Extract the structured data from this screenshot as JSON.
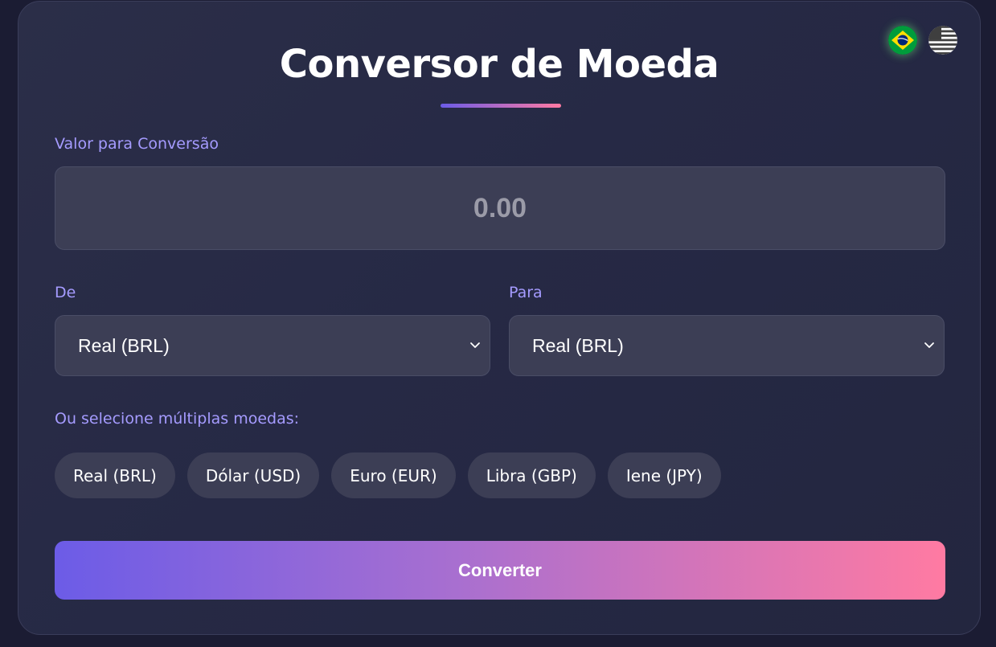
{
  "header": {
    "title": "Conversor de Moeda",
    "languages": [
      {
        "code": "pt-BR",
        "icon": "brazil-flag-icon",
        "active": true
      },
      {
        "code": "en-US",
        "icon": "usa-flag-icon",
        "active": false
      }
    ]
  },
  "amount": {
    "label": "Valor para Conversão",
    "placeholder": "0.00",
    "value": ""
  },
  "from": {
    "label": "De",
    "selected": "Real (BRL)"
  },
  "to": {
    "label": "Para",
    "selected": "Real (BRL)"
  },
  "multi": {
    "label": "Ou selecione múltiplas moedas:",
    "options": [
      "Real (BRL)",
      "Dólar (USD)",
      "Euro (EUR)",
      "Libra (GBP)",
      "Iene (JPY)"
    ]
  },
  "actions": {
    "convert_label": "Converter"
  },
  "colors": {
    "accent_start": "#6c5ce7",
    "accent_end": "#ff7aa2",
    "label": "#a59bff",
    "field_bg": "#3c3e55",
    "card_bg": "#282b46"
  }
}
